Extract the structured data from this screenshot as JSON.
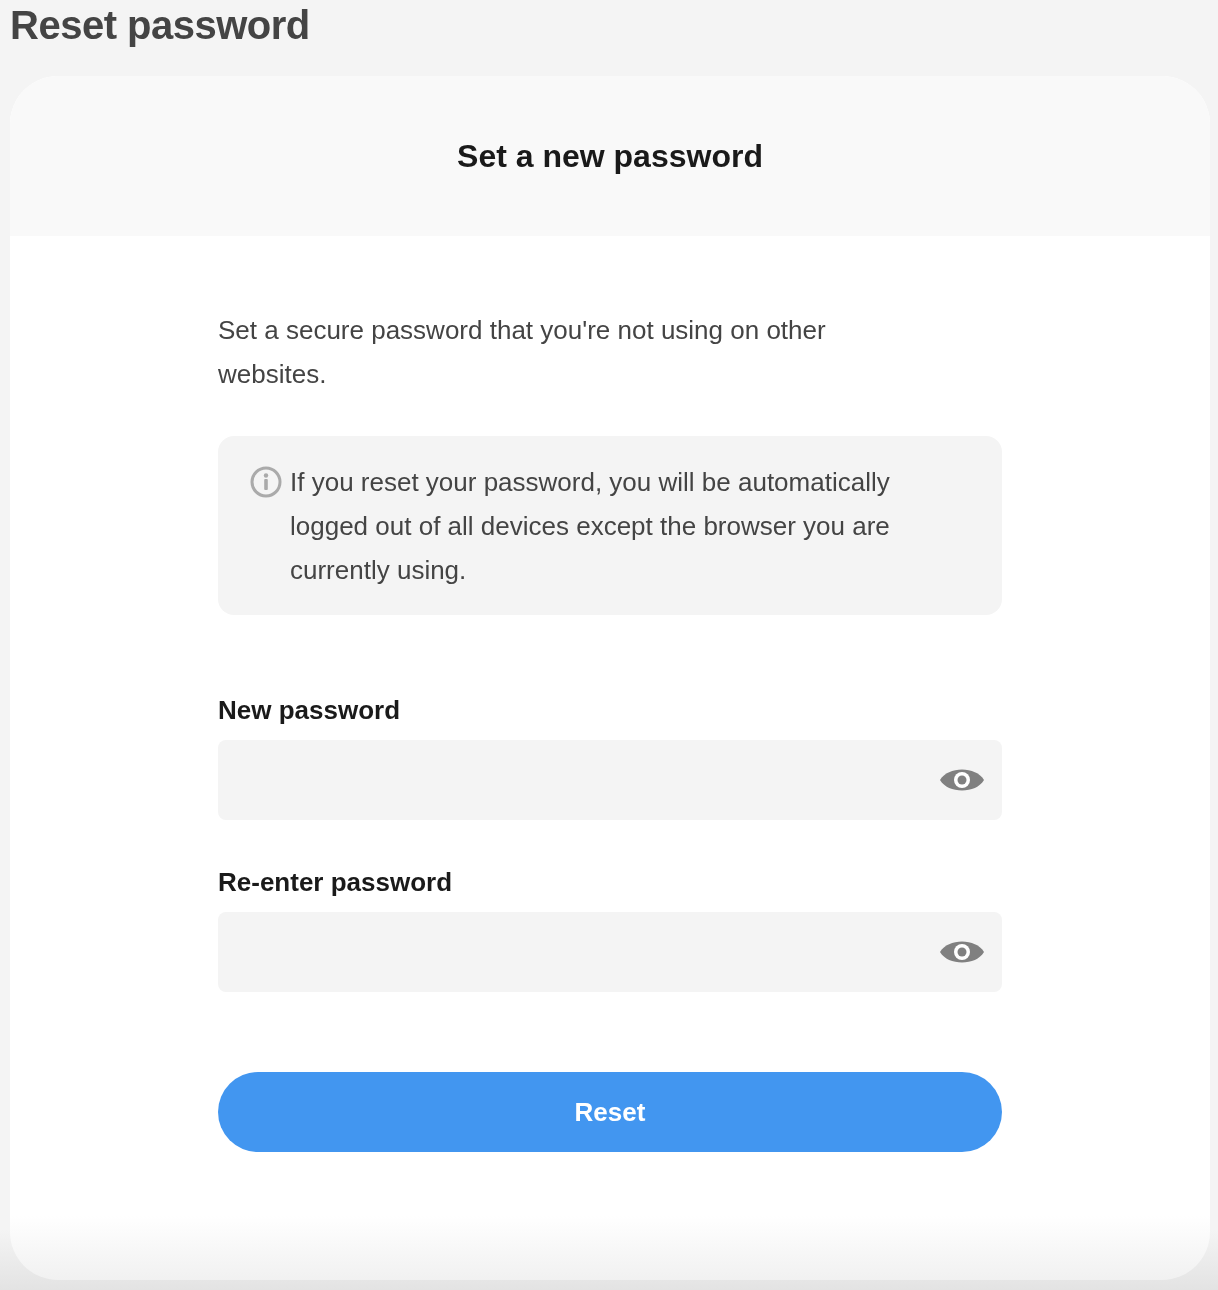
{
  "page": {
    "title": "Reset password"
  },
  "card": {
    "heading": "Set a new password",
    "description": "Set a secure password that you're not using on other websites.",
    "notice": {
      "text": "If you reset your password, you will be automatically logged out of all devices except the browser you are currently using."
    }
  },
  "fields": [
    {
      "label": "New password"
    },
    {
      "label": "Re-enter password"
    }
  ],
  "button": {
    "label": "Reset"
  }
}
